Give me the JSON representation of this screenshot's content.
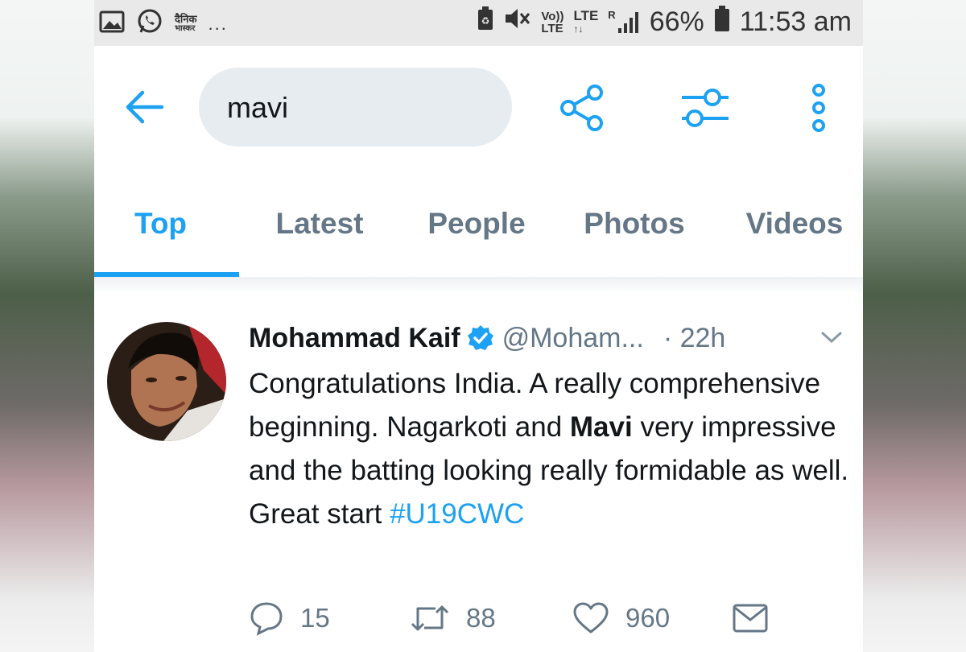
{
  "status_bar": {
    "carrier_line1": "दैनिक",
    "carrier_line2": "भास्कर",
    "more": "...",
    "volte_line1": "Vo))",
    "volte_line2": "LTE",
    "network": "LTE",
    "roaming": "R",
    "battery": "66%",
    "time": "11:53 am"
  },
  "search": {
    "query": "mavi"
  },
  "tabs": [
    {
      "label": "Top",
      "active": true
    },
    {
      "label": "Latest"
    },
    {
      "label": "People"
    },
    {
      "label": "Photos"
    },
    {
      "label": "Videos"
    }
  ],
  "tweet": {
    "name": "Mohammad Kaif",
    "handle": "@Moham...",
    "time_sep": "·",
    "time": "22h",
    "text_part1": "Congratulations India. A really comprehensive beginning. Nagarkoti and ",
    "text_bold": "Mavi",
    "text_part2": " very impressive and the batting looking really formidable as well. Great start ",
    "hashtag": "#U19CWC",
    "replies": "15",
    "retweets": "88",
    "likes": "960"
  },
  "colors": {
    "accent": "#1da1f2",
    "secondary_text": "#657786",
    "primary_text": "#14171a",
    "search_bg": "#e6ecf0"
  },
  "icons": {
    "back": "arrow-left-icon",
    "share": "share-icon",
    "filter": "sliders-icon",
    "overflow": "more-vertical-icon",
    "verified": "verified-badge-icon",
    "caret": "chevron-down-icon",
    "reply": "reply-icon",
    "retweet": "retweet-icon",
    "like": "heart-icon",
    "dm": "mail-icon"
  }
}
